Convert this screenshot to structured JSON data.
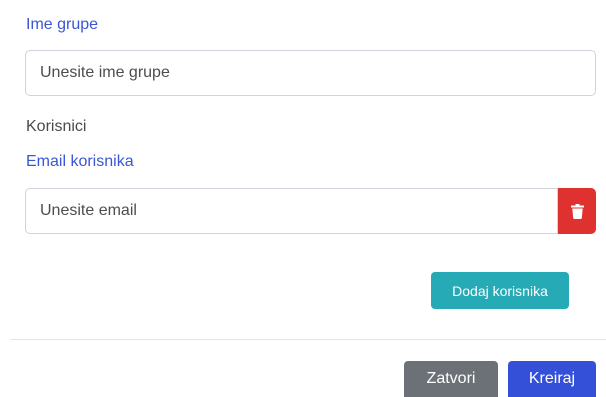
{
  "group": {
    "name_label": "Ime grupe",
    "name_placeholder": "Unesite ime grupe"
  },
  "users": {
    "section_label": "Korisnici",
    "email_label": "Email korisnika",
    "email_placeholder": "Unesite email",
    "delete_icon": "trash-icon",
    "add_button": "Dodaj korisnika"
  },
  "footer": {
    "close_button": "Zatvori",
    "create_button": "Kreiraj"
  },
  "colors": {
    "accent": "#3450d8",
    "danger": "#e03131",
    "info": "#26aab5",
    "secondary": "#6c7178"
  }
}
